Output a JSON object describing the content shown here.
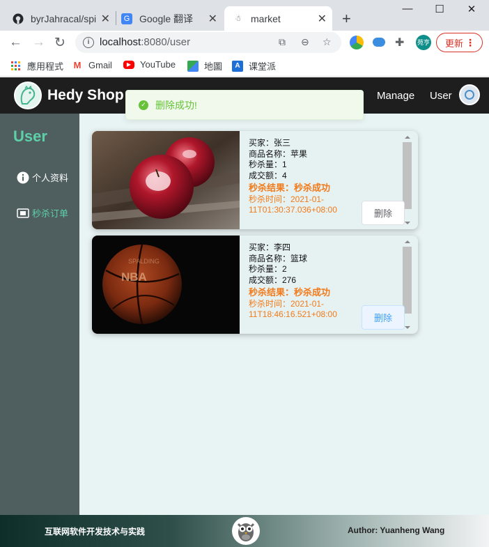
{
  "tabs": [
    {
      "title": "byrJahracal/spik",
      "icon": "github-icon"
    },
    {
      "title": "Google 翻译",
      "icon": "google-translate-icon"
    },
    {
      "title": "market",
      "icon": "market-favicon-icon"
    }
  ],
  "address": {
    "host": "localhost",
    "path": ":8080/user"
  },
  "update_label": "更新",
  "profile_label": "苑亨",
  "bookmarks": [
    {
      "label": "應用程式",
      "icon": "apps-grid-icon"
    },
    {
      "label": "Gmail",
      "icon": "gmail-icon"
    },
    {
      "label": "YouTube",
      "icon": "youtube-icon"
    },
    {
      "label": "地圖",
      "icon": "maps-icon"
    },
    {
      "label": "课堂派",
      "icon": "ketangpai-icon"
    }
  ],
  "site": {
    "brand": "Hedy Shop",
    "nav": [
      "Manage",
      "User"
    ]
  },
  "sidebar": {
    "title": "User",
    "items": [
      {
        "label": "个人资料",
        "icon": "info-icon",
        "color": "#ffffff"
      },
      {
        "label": "秒杀订单",
        "icon": "order-icon",
        "color": "#5ed0a8"
      }
    ]
  },
  "toast": {
    "message": "删除成功!"
  },
  "orders": [
    {
      "buyer": "买家：张三",
      "product": "商品名称：苹果",
      "quantity": "秒杀量：1",
      "amount": "成交额：4",
      "result": "秒杀结果：秒杀成功",
      "time_line1": "秒杀时间：2021-01-",
      "time_line2": "11T01:30:37.036+08:00",
      "delete_label": "删除"
    },
    {
      "buyer": "买家：李四",
      "product": "商品名称：篮球",
      "quantity": "秒杀量：2",
      "amount": "成交额：276",
      "result": "秒杀结果：秒杀成功",
      "time_line1": "秒杀时间：2021-01-",
      "time_line2": "11T18:46:16.521+08:00",
      "delete_label": "删除"
    }
  ],
  "footer": {
    "left": "互联网软件开发技术与实践",
    "right": "Author: Yuanheng Wang"
  },
  "colors": {
    "accent": "#5ed0a8",
    "result": "#f27a1a",
    "success": "#67c23a",
    "sidebar": "#4f5e5e"
  }
}
